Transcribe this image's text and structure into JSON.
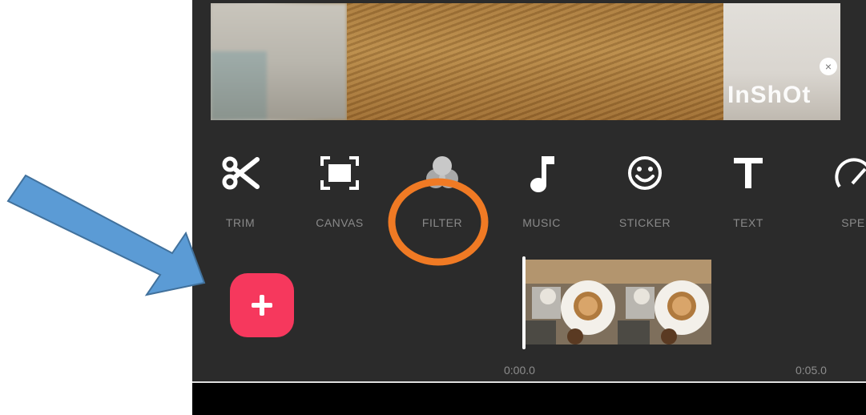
{
  "watermark": {
    "text": "InShOt",
    "close_glyph": "×"
  },
  "toolbar": {
    "items": [
      {
        "label": "TRIM",
        "icon": "scissors-icon"
      },
      {
        "label": "CANVAS",
        "icon": "canvas-icon"
      },
      {
        "label": "FILTER",
        "icon": "filter-icon"
      },
      {
        "label": "MUSIC",
        "icon": "music-note-icon"
      },
      {
        "label": "STICKER",
        "icon": "smiley-icon"
      },
      {
        "label": "TEXT",
        "icon": "text-icon"
      },
      {
        "label": "SPE",
        "icon": "speed-icon"
      }
    ]
  },
  "add_button": {
    "glyph": "+"
  },
  "timeline": {
    "start": "0:00.0",
    "end": "0:05.0"
  },
  "colors": {
    "background": "#2b2b2b",
    "add_button": "#f6385d",
    "highlight_circle": "#f07a24",
    "arrow_fill": "#5b9bd5",
    "arrow_stroke": "#41719c"
  }
}
